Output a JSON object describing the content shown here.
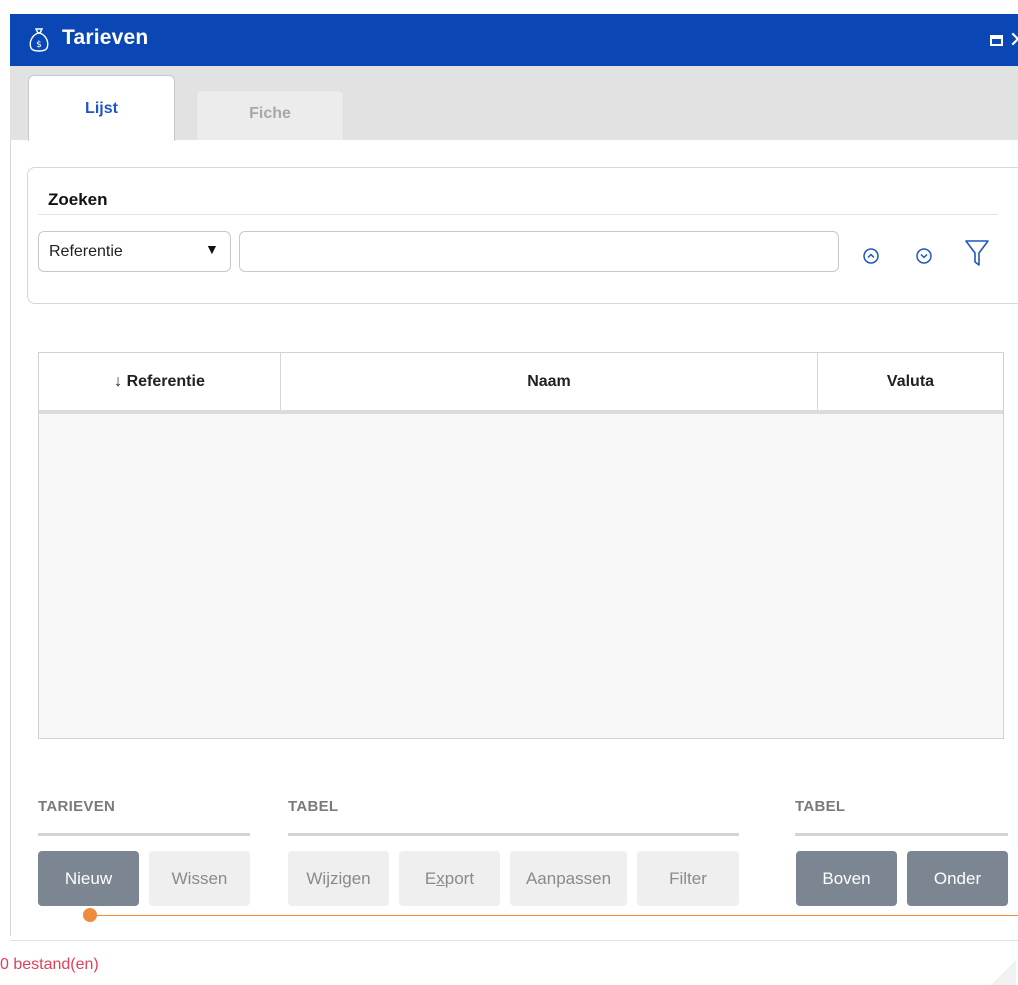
{
  "window": {
    "title": "Tarieven",
    "icon": "money-bag-icon",
    "close_glyph": "✕"
  },
  "tabs": [
    {
      "label": "Lijst",
      "active": true
    },
    {
      "label": "Fiche",
      "active": false
    }
  ],
  "search": {
    "title": "Zoeken",
    "field_selected": "Referentie",
    "dropdown_glyph": "▼",
    "input_value": "",
    "input_placeholder": ""
  },
  "table": {
    "columns": [
      {
        "label": "↓ Referentie"
      },
      {
        "label": "Naam"
      },
      {
        "label": "Valuta"
      }
    ],
    "rows": []
  },
  "groups": {
    "tarieven": {
      "label": "TARIEVEN",
      "buttons": {
        "nieuw": "Nieuw",
        "wissen": "Wissen"
      }
    },
    "tabel1": {
      "label": "TABEL",
      "buttons": {
        "wijzigen": "Wijzigen",
        "export_e": "E",
        "export_x": "x",
        "export_rest": "port",
        "aanpassen": "Aanpassen",
        "filter": "Filter"
      }
    },
    "tabel2": {
      "label": "TABEL",
      "buttons": {
        "boven": "Boven",
        "onder": "Onder"
      }
    }
  },
  "colors": {
    "titlebar": "#0a47b5",
    "active_tab_text": "#1f57c3",
    "accent_orange": "#f08a3c",
    "status_text": "#e0405a",
    "dark_button": "#7c8693"
  },
  "footer": {
    "status": "0 bestand(en)"
  }
}
